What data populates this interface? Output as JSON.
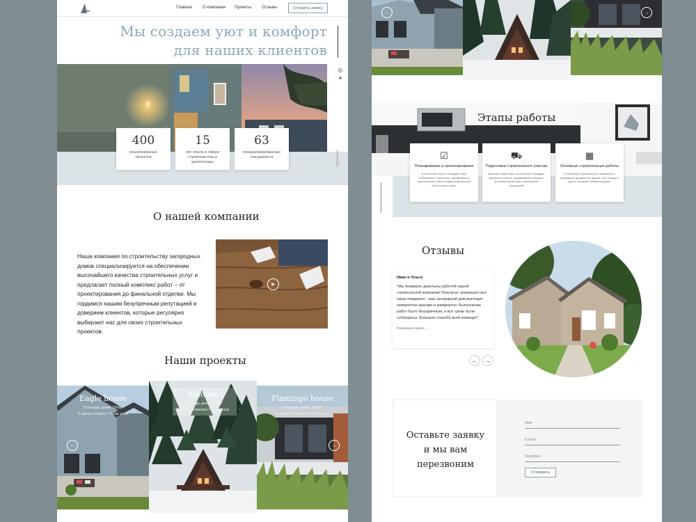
{
  "nav": {
    "items": [
      "Главная",
      "О компании",
      "Проекты",
      "Отзывы"
    ],
    "cta": "Оставить заявку"
  },
  "hero": {
    "title_line1": "Мы создаем уют и комфорт",
    "title_line2": "для наших клиентов",
    "social_text": "INSTAGRAM",
    "stats": [
      {
        "value": "400",
        "label": "реализованных проектов"
      },
      {
        "value": "15",
        "label": "лет опыта в сфере строительства и архитектуры"
      },
      {
        "value": "63",
        "label": "специализированных специалиста"
      }
    ]
  },
  "about": {
    "title": "О нашей компании",
    "text": "Наша компания по строительству загородных домов специализируется на обеспечении высочайшего качества строительных услуг и предлагает полный комплекс работ – от проектирования до финальной отделки. Мы гордимся нашим безупречным репутацией и доверием клиентов, которые регулярно выбирают нас для своих строительных проектов."
  },
  "projects": {
    "title": "Наши проекты",
    "items": [
      {
        "name": "Eagle house",
        "area": "Площадь дома: 150м²",
        "rooms": "5 жилых комнат / 2 сан узла"
      },
      {
        "name": "A-house",
        "area": "Площадь дома: 120м²",
        "rooms": "3 жилых комнаты / 2 сан узла"
      },
      {
        "name": "Flamingo house",
        "area": "Площадь дома: 180м²",
        "rooms": "4 жилых комнаты / 2 сан узла"
      }
    ]
  },
  "stages": {
    "title": "Этапы работы",
    "items": [
      {
        "icon": "checklist-icon",
        "title": "Планирование и проектирование",
        "text": "В этом этапе клиент обсуждает свои требования и пожелания с дизайнером и архитектором. Затем создается детальный план и проект дома."
      },
      {
        "icon": "lawnmower-icon",
        "title": "Подготовка строительного участка",
        "text": "Включает подготовку строительной площадки, земельные работы, выравнивание участка и установку временных строительных сооружений."
      },
      {
        "icon": "bricks-icon",
        "title": "Основные строительные работы",
        "text": "В этом этапе строительство начинается с возведения фундамента здания, стен, крыши и других основных элементов дома."
      }
    ]
  },
  "reviews": {
    "title": "Отзывы",
    "author": "Иван и Ольга:",
    "text": "\"Мы безмерно довольны работой нашей строительной компании! Результат превзошел все наши ожидания - наш загородный дом выглядит невероятно красиво и комфортно. Выполнение работ было безупречным, и все сроки были соблюдены. Большое спасибо всей команде!\"",
    "more": "Посмотреть проект →"
  },
  "form": {
    "title_line1": "Оставьте заявку",
    "title_line2": "и мы вам",
    "title_line3": "перезвоним",
    "name_placeholder": "Имя",
    "email_placeholder": "E-mail",
    "phone_placeholder": "Телефон",
    "submit": "Отправить"
  },
  "colors": {
    "background": "#808d92",
    "accent": "#8fa6b3",
    "band": "#dce3e7"
  }
}
